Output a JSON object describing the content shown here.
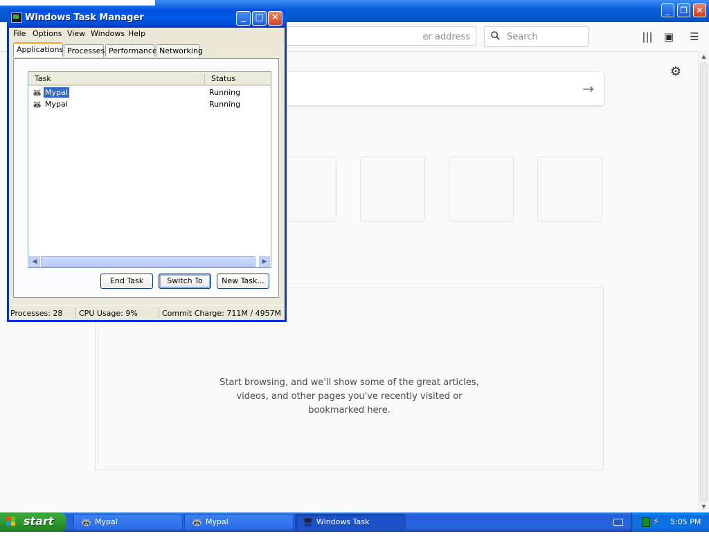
{
  "browser": {
    "url_placeholder": "er address",
    "search_placeholder": "Search",
    "highlights_text": [
      "Start browsing, and we'll show some of the great articles,",
      "videos, and other pages you've recently visited or",
      "bookmarked here."
    ]
  },
  "task_manager": {
    "title": "Windows Task Manager",
    "menu": [
      "File",
      "Options",
      "View",
      "Windows",
      "Help"
    ],
    "tabs": [
      "Applications",
      "Processes",
      "Performance",
      "Networking"
    ],
    "columns": [
      "Task",
      "Status"
    ],
    "rows": [
      {
        "task": "Mypal",
        "status": "Running",
        "selected": true
      },
      {
        "task": "Mypal",
        "status": "Running",
        "selected": false
      }
    ],
    "buttons": {
      "end_task": "End Task",
      "switch_to": "Switch To",
      "new_task": "New Task..."
    },
    "status_bar": {
      "processes": "Processes: 28",
      "cpu": "CPU Usage: 9%",
      "commit": "Commit Charge: 711M / 4957M"
    }
  },
  "taskbar": {
    "start_label": "start",
    "items": [
      "Mypal",
      "Mypal",
      "Windows Task Manager"
    ],
    "clock": "5:05 PM"
  },
  "colors": {
    "xp_blue": "#0831d9",
    "start_green": "#2f9a2f",
    "selection": "#316ac5"
  }
}
